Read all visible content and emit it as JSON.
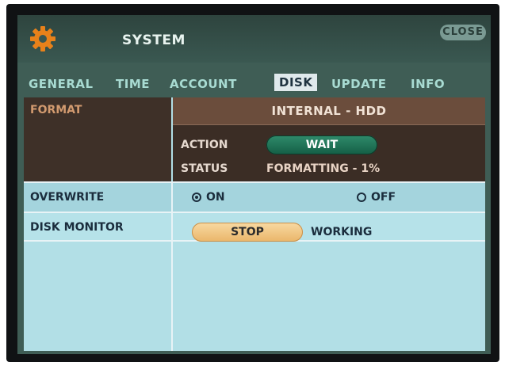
{
  "header": {
    "title": "SYSTEM",
    "close_label": "CLOSE",
    "gear_color": "#e8811a"
  },
  "tabs": [
    {
      "label": "GENERAL",
      "active": false
    },
    {
      "label": "TIME",
      "active": false
    },
    {
      "label": "ACCOUNT",
      "active": false
    },
    {
      "label": "DISK",
      "active": true
    },
    {
      "label": "UPDATE",
      "active": false
    },
    {
      "label": "INFO",
      "active": false
    }
  ],
  "format": {
    "label": "FORMAT",
    "target": "INTERNAL - HDD",
    "action_label": "ACTION",
    "action_button": "WAIT",
    "status_label": "STATUS",
    "status_value": "FORMATTING - 1%"
  },
  "overwrite": {
    "label": "OVERWRITE",
    "options": [
      "ON",
      "OFF"
    ],
    "selected": "ON"
  },
  "disk_monitor": {
    "label": "DISK MONITOR",
    "button_label": "STOP",
    "status": "WORKING"
  }
}
